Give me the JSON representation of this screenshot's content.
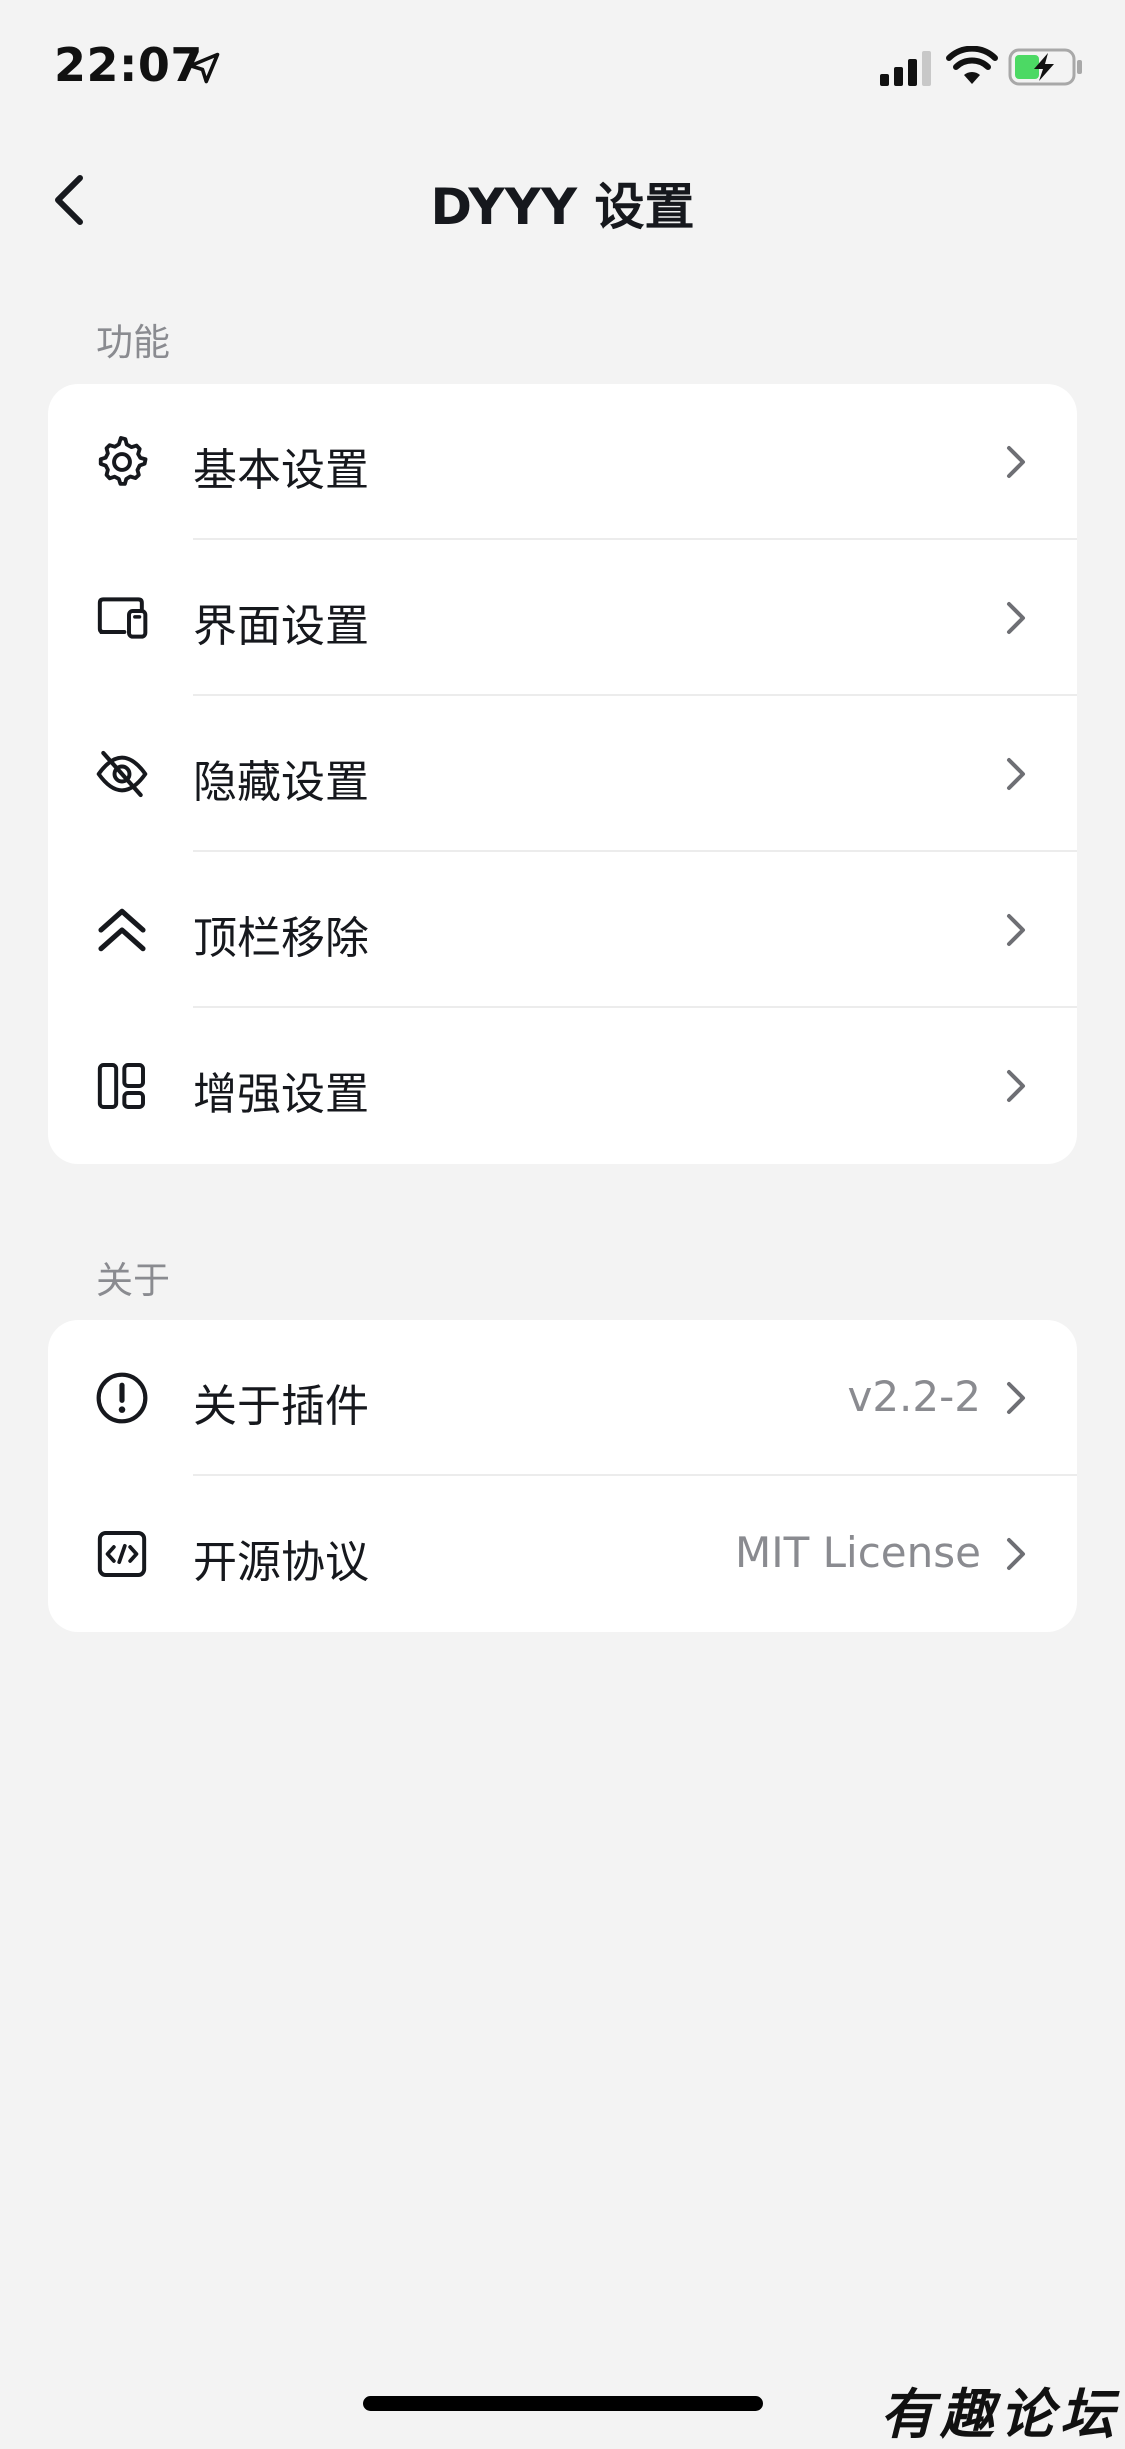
{
  "status_bar": {
    "time": "22:07"
  },
  "nav": {
    "title": "DYYY 设置"
  },
  "sections": {
    "features": {
      "header": "功能",
      "items": [
        {
          "label": "基本设置",
          "icon": "gear-icon"
        },
        {
          "label": "界面设置",
          "icon": "devices-icon"
        },
        {
          "label": "隐藏设置",
          "icon": "eye-off-icon"
        },
        {
          "label": "顶栏移除",
          "icon": "double-chevron-up-icon"
        },
        {
          "label": "增强设置",
          "icon": "layout-icon"
        }
      ]
    },
    "about": {
      "header": "关于",
      "items": [
        {
          "label": "关于插件",
          "value": "v2.2-2",
          "icon": "info-icon"
        },
        {
          "label": "开源协议",
          "value": "MIT License",
          "icon": "code-icon"
        }
      ]
    }
  },
  "colors": {
    "background": "#f3f3f3",
    "card": "#ffffff",
    "text_primary": "#16181d",
    "text_secondary": "#8a8b90",
    "battery_fill": "#4cd964"
  },
  "watermark": "有趣论坛"
}
